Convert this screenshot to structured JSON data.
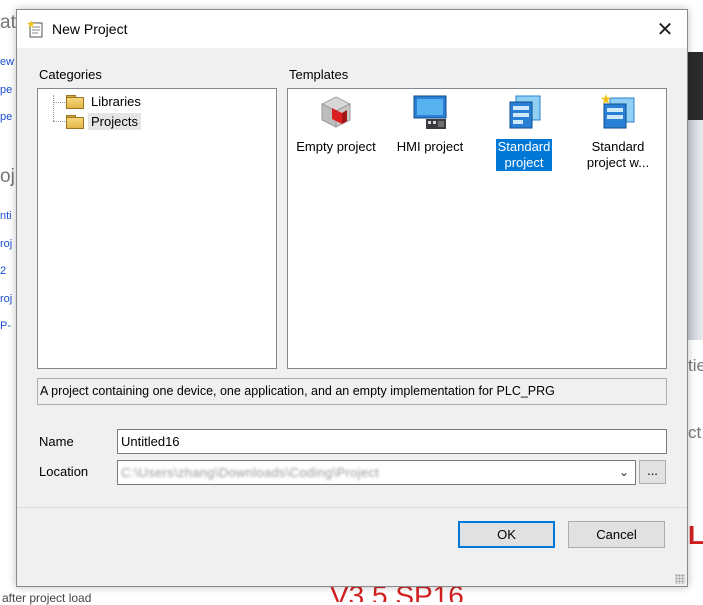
{
  "background": {
    "left_fragments": [
      "at",
      "ew",
      "pe",
      "pe",
      "oj",
      "nti",
      "roj",
      "2",
      "roj",
      "P-"
    ],
    "right_fragments": [
      "tie",
      "ct."
    ],
    "right_red_text": "L",
    "bottom_left_text": "after project load",
    "bottom_red_text": "V3.5 SP16"
  },
  "dialog": {
    "title": "New Project",
    "close_glyph": "✕",
    "categories_label": "Categories",
    "templates_label": "Templates",
    "categories": [
      {
        "label": "Libraries",
        "selected": false
      },
      {
        "label": "Projects",
        "selected": true
      }
    ],
    "templates": [
      {
        "name": "Empty project",
        "icon": "empty-project-icon",
        "selected": false
      },
      {
        "name": "HMI project",
        "icon": "hmi-project-icon",
        "selected": false
      },
      {
        "name_line1": "Standard",
        "name_line2": "project",
        "icon": "standard-project-icon",
        "selected": true
      },
      {
        "name_line1": "Standard",
        "name_line2": "project w...",
        "icon": "standard-project-wizard-icon",
        "selected": false
      }
    ],
    "description": "A project containing one device, one application, and an empty implementation for PLC_PRG",
    "name_label": "Name",
    "name_value": "Untitled16",
    "location_label": "Location",
    "location_value": "C:\\Users\\zhang\\Downloads\\Coding\\Project",
    "browse_label": "...",
    "ok_label": "OK",
    "cancel_label": "Cancel",
    "accent_color": "#0078d7"
  }
}
